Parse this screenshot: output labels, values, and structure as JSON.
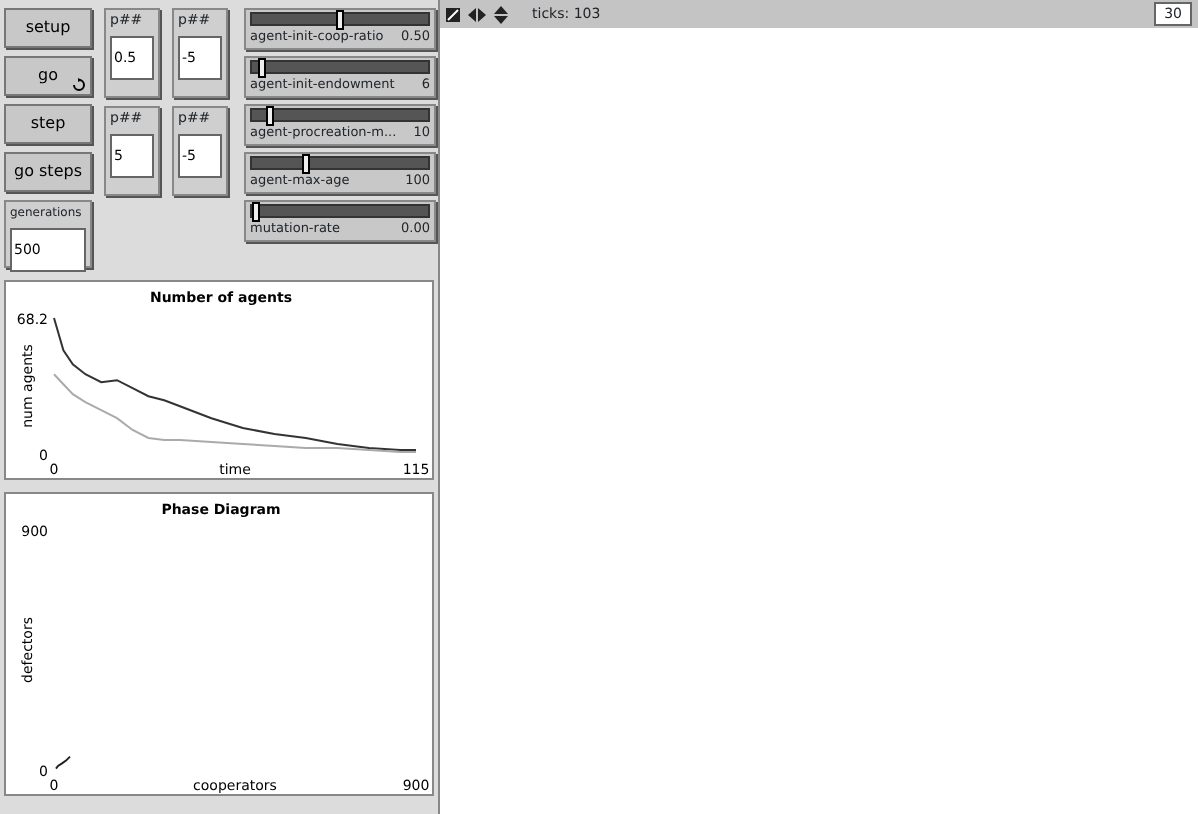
{
  "buttons": [
    {
      "label": "setup",
      "forever": false
    },
    {
      "label": "go",
      "forever": true
    },
    {
      "label": "step",
      "forever": false
    },
    {
      "label": "go steps",
      "forever": false
    }
  ],
  "generations": {
    "label": "generations",
    "value": "500"
  },
  "inputs": [
    {
      "label": "p##",
      "value": "0.5"
    },
    {
      "label": "p##",
      "value": "-5"
    },
    {
      "label": "p##",
      "value": "5"
    },
    {
      "label": "p##",
      "value": "-5"
    }
  ],
  "sliders": [
    {
      "name": "agent-init-coop-ratio",
      "reading": "0.50",
      "level": 0.5
    },
    {
      "name": "agent-init-endowment",
      "reading": "6",
      "level": 0.03
    },
    {
      "name": "agent-procreation-m...",
      "reading": "10",
      "level": 0.08
    },
    {
      "name": "agent-max-age",
      "reading": "100",
      "level": 0.3
    },
    {
      "name": "mutation-rate",
      "reading": "0.00",
      "level": 0
    }
  ],
  "plots": [
    {
      "chart_data": {
        "type": "line",
        "title": "Number of agents",
        "xlabel": "time",
        "ylabel": "num agents",
        "xlim": [
          0,
          115
        ],
        "ylim": [
          0,
          68.2
        ],
        "xticks": [
          0,
          115
        ],
        "yticks": [
          0,
          68.2
        ],
        "x": [
          0,
          3,
          6,
          10,
          15,
          20,
          25,
          30,
          35,
          40,
          50,
          60,
          70,
          80,
          90,
          100,
          110,
          115
        ],
        "series": [
          {
            "color": "#333333",
            "values": [
              68.2,
              52,
              45,
              40,
              36,
              37,
              33,
              29,
              27,
              24,
              18,
              13,
              10,
              8,
              5,
              3,
              2,
              2
            ]
          },
          {
            "color": "#aaaaaa",
            "values": [
              40,
              35,
              30,
              26,
              22,
              18,
              12,
              8,
              7,
              7,
              6,
              5,
              4,
              3,
              3,
              2,
              1,
              1
            ]
          }
        ]
      }
    },
    {
      "chart_data": {
        "type": "line",
        "title": "Phase Diagram",
        "xlabel": "cooperators",
        "ylabel": "defectors",
        "xlim": [
          0,
          900
        ],
        "ylim": [
          0,
          900
        ],
        "xticks": [
          0,
          900
        ],
        "yticks": [
          0,
          900
        ],
        "x": [
          5,
          10,
          20,
          30,
          40
        ],
        "series": [
          {
            "color": "#222222",
            "values": [
              5,
              15,
              25,
              35,
              50
            ]
          }
        ]
      }
    }
  ],
  "view": {
    "ticks_label": "ticks: 103",
    "speed": "30"
  }
}
